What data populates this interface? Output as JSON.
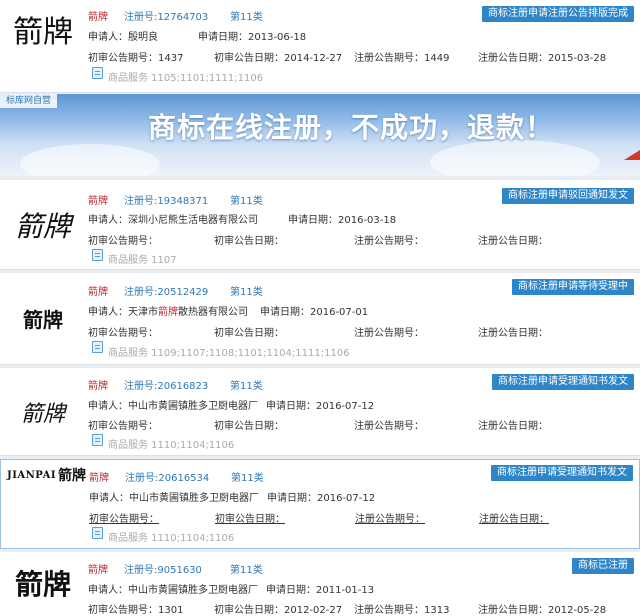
{
  "accent_color": "#2e86c9",
  "brand_color": "#c0272d",
  "cards": [
    {
      "logo": "箭牌",
      "brand": "箭牌",
      "reg_no": "注册号:12764703",
      "class": "第11类",
      "status": "商标注册申请注册公告排版完成",
      "applicant": "申请人：殷明良",
      "apply_date": "申请日期：2013-06-18",
      "prelim_no": "初审公告期号：1437",
      "prelim_date": "初审公告日期：2014-12-27",
      "reg_pub_no": "注册公告期号：1449",
      "reg_pub_date": "注册公告日期：2015-03-28",
      "services": "商品服务  1105;1101;1111;1106"
    },
    {
      "logo": "箭牌",
      "brand": "箭牌",
      "reg_no": "注册号:19348371",
      "class": "第11类",
      "status": "商标注册申请驳回通知发文",
      "applicant": "申请人：深圳小尼熊生活电器有限公司",
      "apply_date": "申请日期：2016-03-18",
      "prelim_no": "初审公告期号：",
      "prelim_date": "初审公告日期：",
      "reg_pub_no": "注册公告期号：",
      "reg_pub_date": "注册公告日期：",
      "services": "商品服务  1107"
    },
    {
      "logo": "箭牌",
      "brand": "箭牌",
      "reg_no": "注册号:20512429",
      "class": "第11类",
      "status": "商标注册申请等待受理中",
      "applicant_prefix": "申请人：天津市",
      "applicant_highlight": "箭牌",
      "applicant_suffix": "散热器有限公司",
      "apply_date": "申请日期：2016-07-01",
      "prelim_no": "初审公告期号：",
      "prelim_date": "初审公告日期：",
      "reg_pub_no": "注册公告期号：",
      "reg_pub_date": "注册公告日期：",
      "services": "商品服务  1109;1107;1108;1101;1104;1111;1106"
    },
    {
      "logo": "箭牌",
      "brand": "箭牌",
      "reg_no": "注册号:20616823",
      "class": "第11类",
      "status": "商标注册申请受理通知书发文",
      "applicant": "申请人：中山市黄圃镇胜多卫厨电器厂",
      "apply_date": "申请日期：2016-07-12",
      "prelim_no": "初审公告期号：",
      "prelim_date": "初审公告日期：",
      "reg_pub_no": "注册公告期号：",
      "reg_pub_date": "注册公告日期：",
      "services": "商品服务  1110;1104;1106"
    },
    {
      "logo_latin": "JIANPAI",
      "logo": "箭牌",
      "brand": "箭牌",
      "reg_no": "注册号:20616534",
      "class": "第11类",
      "status": "商标注册申请受理通知书发文",
      "applicant": "申请人：中山市黄圃镇胜多卫厨电器厂",
      "apply_date": "申请日期：2016-07-12",
      "prelim_no": "初审公告期号：",
      "prelim_date": "初审公告日期：",
      "reg_pub_no": "注册公告期号：",
      "reg_pub_date": "注册公告日期：",
      "services": "商品服务  1110;1104;1106"
    },
    {
      "logo": "箭牌",
      "brand": "箭牌",
      "reg_no": "注册号:9051630",
      "class": "第11类",
      "status": "商标已注册",
      "applicant": "申请人：中山市黄圃镇胜多卫厨电器厂",
      "apply_date": "申请日期：2011-01-13",
      "prelim_no": "初审公告期号：1301",
      "prelim_date": "初审公告日期：2012-02-27",
      "reg_pub_no": "注册公告期号：1313",
      "reg_pub_date": "注册公告日期：2012-05-28"
    }
  ],
  "banner": {
    "tag": "标库网自营",
    "slogan": "商标在线注册，不成功，退款！"
  }
}
